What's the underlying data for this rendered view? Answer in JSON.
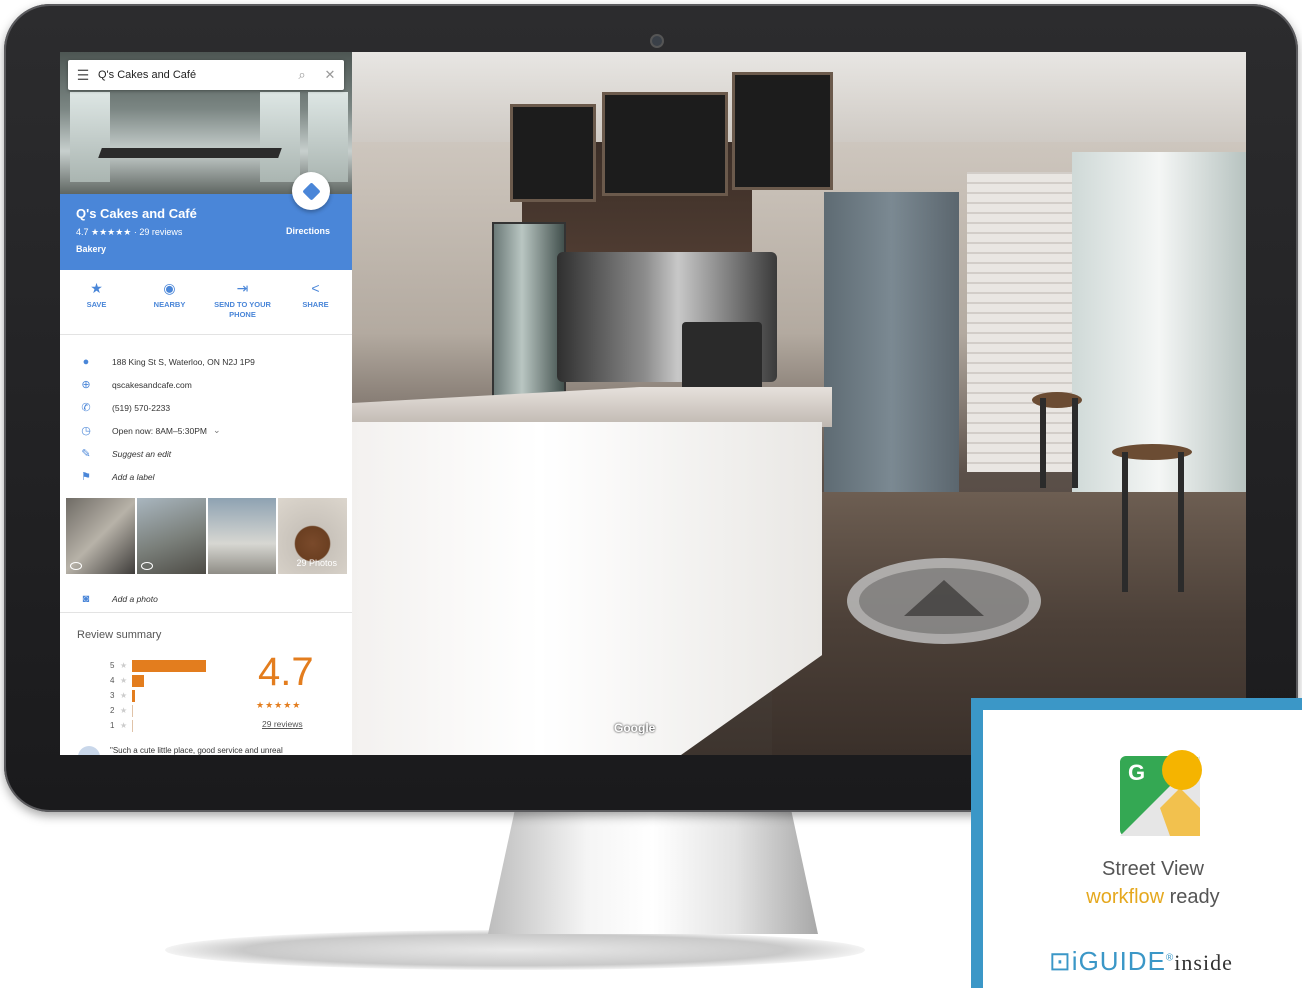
{
  "search": {
    "query": "Q's Cakes and Café"
  },
  "place": {
    "name": "Q's Cakes and Café",
    "rating_line": "4.7 ★★★★★ · 29 reviews",
    "category": "Bakery",
    "directions_label": "Directions"
  },
  "actions": [
    {
      "icon": "star-icon",
      "glyph": "★",
      "label": "SAVE"
    },
    {
      "icon": "nearby-icon",
      "glyph": "◉",
      "label": "NEARBY"
    },
    {
      "icon": "send-to-phone-icon",
      "glyph": "⇥",
      "label": "SEND TO YOUR PHONE"
    },
    {
      "icon": "share-icon",
      "glyph": "<",
      "label": "SHARE"
    }
  ],
  "info": {
    "address": "188 King St S, Waterloo, ON N2J 1P9",
    "website": "qscakesandcafe.com",
    "phone": "(519) 570-2233",
    "hours": "Open now:  8AM–5:30PM",
    "suggest_edit": "Suggest an edit",
    "add_label": "Add a label"
  },
  "photos": {
    "count_label": "29 Photos"
  },
  "add_photo": "Add a photo",
  "review_summary": {
    "title": "Review summary",
    "distribution": [
      {
        "stars": "5",
        "fraction": 0.86
      },
      {
        "stars": "4",
        "fraction": 0.14
      },
      {
        "stars": "3",
        "fraction": 0.03
      },
      {
        "stars": "2",
        "fraction": 0.0
      },
      {
        "stars": "1",
        "fraction": 0.0
      }
    ],
    "rating": "4.7",
    "stars": "★★★★★",
    "reviews_link": "29 reviews",
    "quote": "\"Such a cute little place, good service and unreal"
  },
  "street_view": {
    "watermark": "Google"
  },
  "badge": {
    "title": "Street View",
    "sub_workflow": "workflow",
    "sub_ready": " ready",
    "brand": "iGUIDE",
    "brand_suffix": "inside",
    "colors": {
      "frame": "#3b97c7",
      "workflow": "#e5a81e"
    }
  },
  "colors": {
    "accent": "#4a86d8",
    "rating": "#e37d1e"
  }
}
